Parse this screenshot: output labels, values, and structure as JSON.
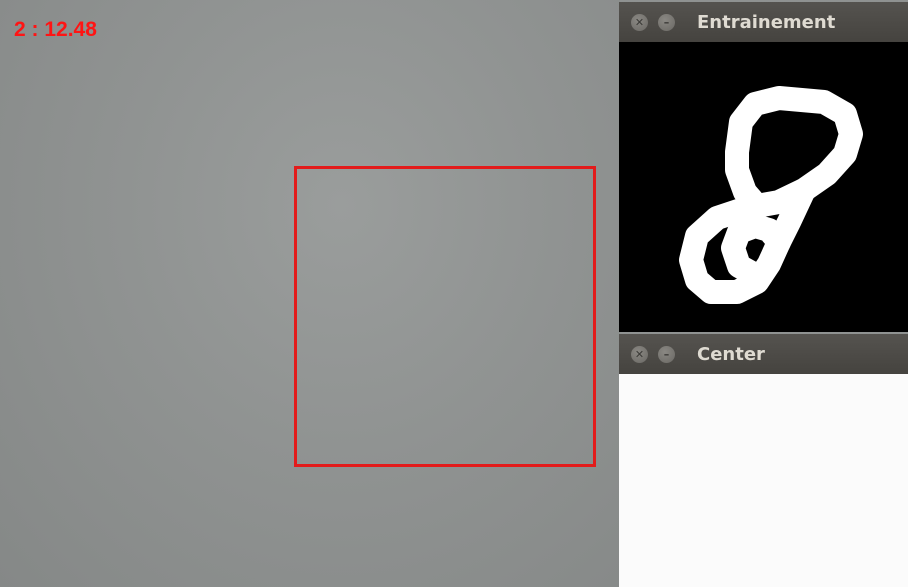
{
  "overlay": {
    "prediction_text": "2 : 12.48"
  },
  "windows": {
    "training": {
      "title": "Entrainement",
      "digit_icon": "handwritten-digit-8"
    },
    "center": {
      "title": "Center"
    }
  },
  "colors": {
    "overlay_text": "#ff1414",
    "roi_box": "#e31b1b",
    "titlebar": "#4d4b47",
    "title_text": "#dfdbd2"
  }
}
